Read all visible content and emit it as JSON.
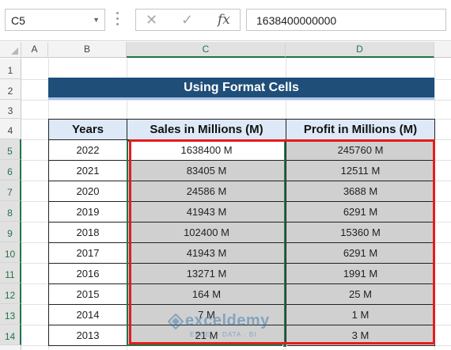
{
  "formula_bar": {
    "name_box": "C5",
    "cancel_icon": "close-icon",
    "enter_icon": "check-icon",
    "fx_label": "fx",
    "formula_value": "1638400000000"
  },
  "columns": [
    "A",
    "B",
    "C",
    "D"
  ],
  "rows": [
    "1",
    "2",
    "3",
    "4",
    "5",
    "6",
    "7",
    "8",
    "9",
    "10",
    "11",
    "12",
    "13",
    "14"
  ],
  "title": "Using Format Cells",
  "table": {
    "headers": [
      "Years",
      "Sales in Millions (M)",
      "Profit in Millions (M)"
    ],
    "rows": [
      [
        "2022",
        "1638400 M",
        "245760 M"
      ],
      [
        "2021",
        "83405 M",
        "12511 M"
      ],
      [
        "2020",
        "24586 M",
        "3688 M"
      ],
      [
        "2019",
        "41943 M",
        "6291 M"
      ],
      [
        "2018",
        "102400 M",
        "15360 M"
      ],
      [
        "2017",
        "41943 M",
        "6291 M"
      ],
      [
        "2016",
        "13271 M",
        "1991 M"
      ],
      [
        "2015",
        "164 M",
        "25 M"
      ],
      [
        "2014",
        "7 M",
        "1 M"
      ],
      [
        "2013",
        "21 M",
        "3 M"
      ]
    ]
  },
  "watermark": {
    "name": "exceldemy",
    "tagline": "EXCEL · DATA · BI"
  },
  "colors": {
    "title_bg": "#1f4e79",
    "header_bg": "#dde9f7",
    "selected_fill": "#d0d0d0",
    "selection_border": "#217346",
    "highlight_border": "#e41c1c"
  }
}
